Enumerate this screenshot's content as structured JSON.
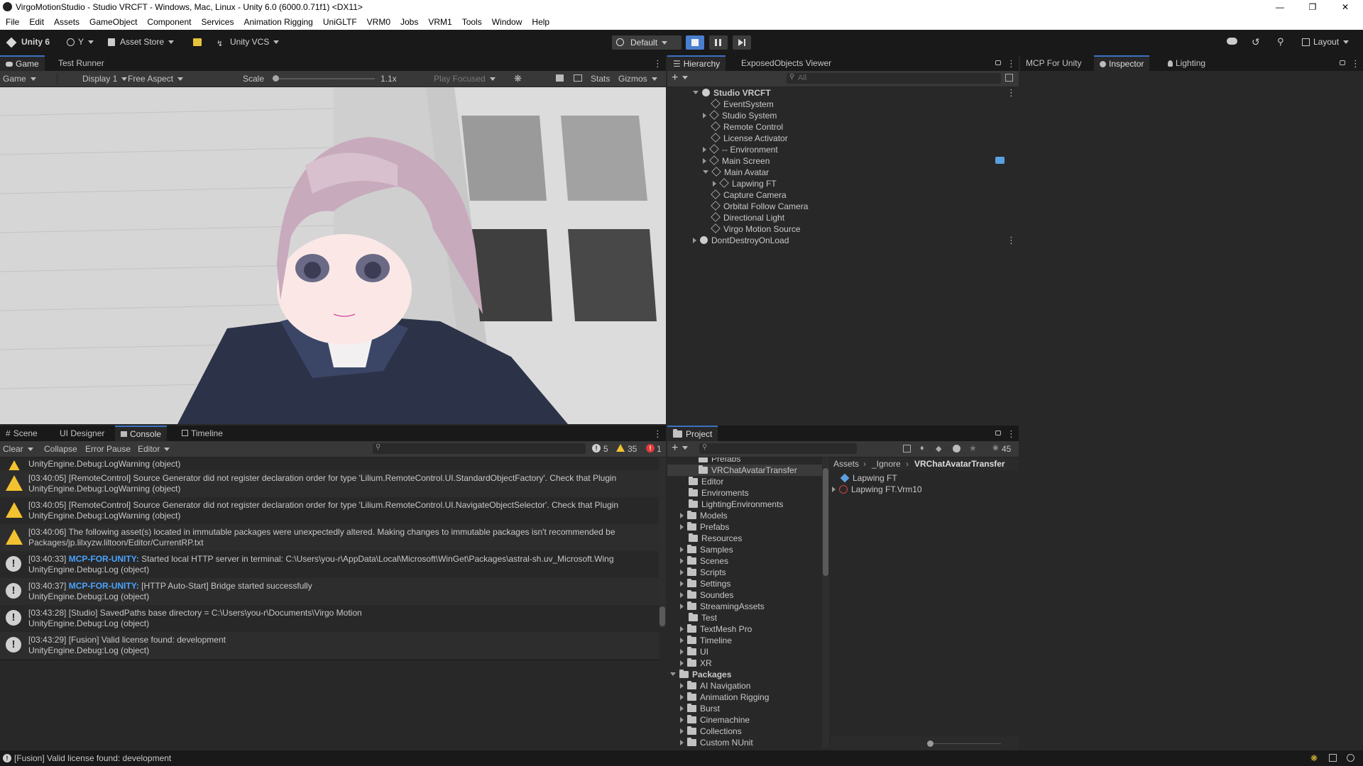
{
  "window": {
    "title": "VirgoMotionStudio - Studio VRCFT - Windows, Mac, Linux - Unity 6.0 (6000.0.71f1) <DX11>"
  },
  "menu": [
    "File",
    "Edit",
    "Assets",
    "GameObject",
    "Component",
    "Services",
    "Animation Rigging",
    "UniGLTF",
    "VRM0",
    "Jobs",
    "VRM1",
    "Tools",
    "Window",
    "Help"
  ],
  "toolbar": {
    "unity": "Unity 6",
    "account": "Y",
    "asset_store": "Asset Store",
    "vcs": "Unity VCS",
    "default": "Default",
    "layout": "Layout"
  },
  "game": {
    "tabs": [
      "Game",
      "Test Runner"
    ],
    "view_mode": "Game",
    "display": "Display 1",
    "aspect": "Free Aspect",
    "scale_label": "Scale",
    "scale_value": "1.1x",
    "play_focused": "Play Focused",
    "stats": "Stats",
    "gizmos": "Gizmos"
  },
  "hierarchy": {
    "tabs": [
      "Hierarchy",
      "ExposedObjects Viewer"
    ],
    "search_placeholder": "All",
    "items": [
      {
        "label": "Studio VRCFT"
      },
      {
        "label": "EventSystem"
      },
      {
        "label": "Studio System"
      },
      {
        "label": "Remote Control"
      },
      {
        "label": "License Activator"
      },
      {
        "label": "-- Environment"
      },
      {
        "label": "Main Screen"
      },
      {
        "label": "Main Avatar"
      },
      {
        "label": "Lapwing FT"
      },
      {
        "label": "Capture Camera"
      },
      {
        "label": "Orbital Follow Camera"
      },
      {
        "label": "Directional Light"
      },
      {
        "label": "Virgo Motion Source"
      },
      {
        "label": "DontDestroyOnLoad"
      }
    ]
  },
  "inspector": {
    "tabs": [
      "MCP For Unity",
      "Inspector",
      "Lighting"
    ]
  },
  "console": {
    "tabs": [
      "Scene",
      "UI Designer",
      "Console",
      "Timeline"
    ],
    "toolbar": {
      "clear": "Clear",
      "collapse": "Collapse",
      "error_pause": "Error Pause",
      "editor": "Editor"
    },
    "counts": {
      "info": "5",
      "warn": "35",
      "error": "1"
    },
    "entries": [
      {
        "type": "warn",
        "prefix": "",
        "text": "[03:40:05] [RemoteControl] Source Generator did not register declaration order for type 'Lilium.RemoteControl.UI.StandardObjectFactory'. Check that Plugin",
        "line2": "UnityEngine.Debug:LogWarning (object)"
      },
      {
        "type": "warn",
        "prefix": "",
        "text": "[03:40:05] [RemoteControl] Source Generator did not register declaration order for type 'Lilium.RemoteControl.UI.NavigateObjectSelector'. Check that Plugin",
        "line2": "UnityEngine.Debug:LogWarning (object)"
      },
      {
        "type": "warn",
        "prefix": "",
        "text": "[03:40:06] The following asset(s) located in immutable packages were unexpectedly altered. Making changes to immutable packages isn't recommended be",
        "line2": "Packages/jp.lilxyzw.liltoon/Editor/CurrentRP.txt"
      },
      {
        "type": "info",
        "prefix": "MCP-FOR-UNITY:",
        "time": "[03:40:33]",
        "text": "Started local HTTP server in terminal: C:\\Users\\you-r\\AppData\\Local\\Microsoft\\WinGet\\Packages\\astral-sh.uv_Microsoft.Wing",
        "line2": "UnityEngine.Debug:Log (object)"
      },
      {
        "type": "info",
        "prefix": "MCP-FOR-UNITY:",
        "time": "[03:40:37]",
        "text": "[HTTP Auto-Start] Bridge started successfully",
        "line2": "UnityEngine.Debug:Log (object)"
      },
      {
        "type": "info",
        "prefix": "",
        "text": "[03:43:28] [Studio] SavedPaths base directory = C:\\Users\\you-r\\Documents\\Virgo Motion",
        "line2": "UnityEngine.Debug:Log (object)"
      },
      {
        "type": "info",
        "prefix": "",
        "text": "[03:43:29] [Fusion] Valid license found: development",
        "line2": "UnityEngine.Debug:Log (object)"
      }
    ],
    "top_line_warning": "UnityEngine.Debug:LogWarning (object)"
  },
  "project": {
    "tab": "Project",
    "asset_count": "45",
    "tree": [
      {
        "label": "Prefabs",
        "arrow": false
      },
      {
        "label": "VRChatAvatarTransfer",
        "arrow": false,
        "selected": true
      },
      {
        "label": "Editor",
        "arrow": false
      },
      {
        "label": "Enviroments",
        "arrow": false
      },
      {
        "label": "LightingEnvironments",
        "arrow": false
      },
      {
        "label": "Models",
        "arrow": true
      },
      {
        "label": "Prefabs",
        "arrow": true
      },
      {
        "label": "Resources",
        "arrow": false
      },
      {
        "label": "Samples",
        "arrow": true
      },
      {
        "label": "Scenes",
        "arrow": true
      },
      {
        "label": "Scripts",
        "arrow": true
      },
      {
        "label": "Settings",
        "arrow": true
      },
      {
        "label": "Soundes",
        "arrow": true
      },
      {
        "label": "StreamingAssets",
        "arrow": true
      },
      {
        "label": "Test",
        "arrow": false
      },
      {
        "label": "TextMesh Pro",
        "arrow": true
      },
      {
        "label": "Timeline",
        "arrow": true
      },
      {
        "label": "UI",
        "arrow": true
      },
      {
        "label": "XR",
        "arrow": true
      },
      {
        "label": "Packages",
        "arrow": true,
        "open": true
      },
      {
        "label": "AI Navigation",
        "arrow": true
      },
      {
        "label": "Animation Rigging",
        "arrow": true
      },
      {
        "label": "Burst",
        "arrow": true
      },
      {
        "label": "Cinemachine",
        "arrow": true
      },
      {
        "label": "Collections",
        "arrow": true
      },
      {
        "label": "Custom NUnit",
        "arrow": true
      }
    ],
    "breadcrumb": [
      "Assets",
      "_Ignore",
      "VRChatAvatarTransfer"
    ],
    "files": [
      "Lapwing FT",
      "Lapwing FT.Vrm10"
    ]
  },
  "status": {
    "text": "[Fusion] Valid license found: development"
  },
  "colors": {
    "accent": "#3a72c2",
    "warning": "#f2c230",
    "mcp": "#4aa3ff",
    "error": "#e03a3a"
  }
}
